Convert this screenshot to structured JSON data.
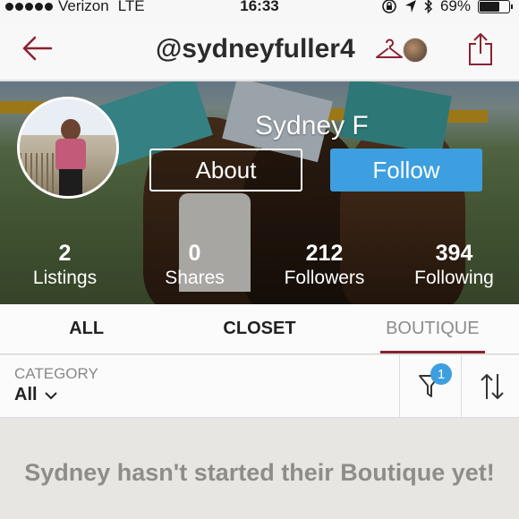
{
  "status_bar": {
    "carrier": "Verizon",
    "network": "LTE",
    "time": "16:33",
    "battery": "69%",
    "battery_level": 0.69
  },
  "nav": {
    "title": "@sydneyfuller4"
  },
  "profile": {
    "name": "Sydney F",
    "about_label": "About",
    "follow_label": "Follow",
    "stats": [
      {
        "value": "2",
        "label": "Listings"
      },
      {
        "value": "0",
        "label": "Shares"
      },
      {
        "value": "212",
        "label": "Followers"
      },
      {
        "value": "394",
        "label": "Following"
      }
    ]
  },
  "tabs": [
    {
      "label": "ALL"
    },
    {
      "label": "CLOSET"
    },
    {
      "label": "BOUTIQUE",
      "active": true
    }
  ],
  "filter": {
    "category_label": "CATEGORY",
    "category_value": "All",
    "filter_badge": "1"
  },
  "empty_state": {
    "message": "Sydney hasn't started their Boutique yet!"
  },
  "colors": {
    "accent": "#8a2231",
    "follow": "#3d9fe0",
    "badge": "#3d9fe0"
  }
}
